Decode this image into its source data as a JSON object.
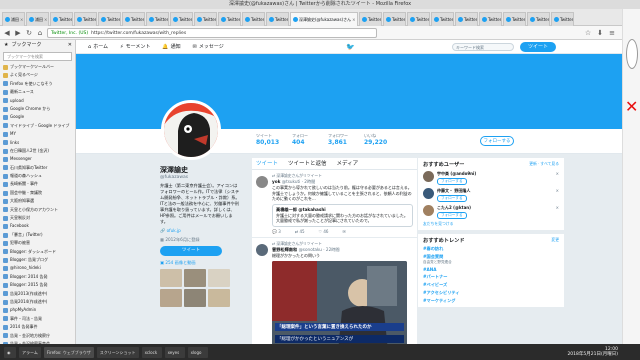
{
  "window": {
    "title": "深澤諭史(@fukazawas)さん | Twitterから削除されたツイート - Mozilla Firefox"
  },
  "tabs": [
    {
      "label": "浦田"
    },
    {
      "label": "浦田"
    },
    {
      "label": "Twitter"
    },
    {
      "label": "Twitter"
    },
    {
      "label": "Twitter"
    },
    {
      "label": "Twitter"
    },
    {
      "label": "Twitter"
    },
    {
      "label": "Twitter"
    },
    {
      "label": "Twitter"
    },
    {
      "label": "Twitter"
    },
    {
      "label": "Twitter"
    },
    {
      "label": "Twitter"
    },
    {
      "label": "深澤諭史(@fukazawas)さん"
    },
    {
      "label": "Twitter"
    },
    {
      "label": "Twitter"
    },
    {
      "label": "Twitter"
    },
    {
      "label": "Twitter"
    },
    {
      "label": "Twitter"
    },
    {
      "label": "Twitter"
    },
    {
      "label": "Twitter"
    },
    {
      "label": "Twitter"
    },
    {
      "label": "Twitter"
    }
  ],
  "active_tab_index": 12,
  "url": {
    "site_label": "Twitter, Inc. (US)",
    "address": "https://twitter.com/fukazawas/with_replies"
  },
  "sidebar": {
    "title": "ブックマーク",
    "search_placeholder": "ブックマークを検索",
    "items": [
      {
        "label": "ブックマークツールバー"
      },
      {
        "label": "よく見るページ"
      },
      {
        "label": "Firefox を使いこなそう"
      },
      {
        "label": "最新ニュース"
      },
      {
        "label": "upload"
      },
      {
        "label": "Google Chrome から"
      },
      {
        "label": "Google"
      },
      {
        "label": "マイドライブ - Google ドライブ"
      },
      {
        "label": "MY"
      },
      {
        "label": "links"
      },
      {
        "label": "在日韓国人2世 (金沢)"
      },
      {
        "label": "Messenger"
      },
      {
        "label": "石川県知事のTwitter"
      },
      {
        "label": "報道の森ハッシュ"
      },
      {
        "label": "長崎新聞 - 事件"
      },
      {
        "label": "国会中継 - 衆議院"
      },
      {
        "label": "大阪府知事選"
      },
      {
        "label": "天皇と小保方のアカウント"
      },
      {
        "label": "天皇制反対"
      },
      {
        "label": "Facebook"
      },
      {
        "label": "「暴言」(Twitter)"
      },
      {
        "label": "犯罪の被害"
      },
      {
        "label": "Blogger: ダッシュボード"
      },
      {
        "label": "Blogger: 告発ブログ"
      },
      {
        "label": "@hirono_hideki"
      },
      {
        "label": "Blogger: 2014 告発"
      },
      {
        "label": "Blogger: 2015 告発"
      },
      {
        "label": "告発2013(作成途中)"
      },
      {
        "label": "告発2014(作成途中)"
      },
      {
        "label": "phpMyAdmin"
      },
      {
        "label": "事件・司法・告発"
      },
      {
        "label": "2014 告発事件"
      },
      {
        "label": "告発・金沢地方検察庁"
      },
      {
        "label": "告発・金沢検察審査会"
      },
      {
        "label": "告発・金沢地方裁判所"
      },
      {
        "label": "Picasaウェブアルバム"
      },
      {
        "label": "行動の記録(今日)"
      }
    ]
  },
  "twitter": {
    "nav": [
      {
        "icon": "home-icon",
        "label": "ホーム"
      },
      {
        "icon": "bolt-icon",
        "label": "モーメント"
      },
      {
        "icon": "bell-icon",
        "label": "通知"
      },
      {
        "icon": "mail-icon",
        "label": "メッセージ"
      }
    ],
    "search_placeholder": "キーワード検索",
    "tweet_button": "ツイート",
    "stats": [
      {
        "label": "ツイート",
        "value": "80,013"
      },
      {
        "label": "フォロー",
        "value": "404"
      },
      {
        "label": "フォロワー",
        "value": "3,861"
      },
      {
        "label": "いいね",
        "value": "29,220"
      }
    ],
    "follow_button": "フォローする",
    "profile": {
      "name": "深澤諭史",
      "handle": "@fukazawas",
      "bio": "弁護士（第二東京弁護士会）。アイコンはフォロワーのヒール作。ITで法律（システム開発紛争、ネットトラブル・詐欺）系。ITと法の一般法務を中心に、労働事件や刑事弁護を取り扱っています。詳しくは、HP参照。ご用件はメールでお願いします。",
      "location": "",
      "link": "ofuk.jp",
      "joined": "2012年6月に登録",
      "tweet_to_button": "ツイート",
      "photos_label": "254 画像と動画"
    },
    "timeline": {
      "tabs": [
        "ツイート",
        "ツイートと返信",
        "メディア"
      ],
      "tweets": [
        {
          "context": "深澤諭史さんがリツイート",
          "author": "yok",
          "handle": "@tsukuti · 2時間",
          "text": "この事実から導かれて欲しいのは当たり前。権は守る必要があるとは言える。弁護士でしょうか。何故か擁護していることを主張されると、依頼人の利益のために動くのがこれを...",
          "quote_author": "高橋雄一郎 @takahashi",
          "quote_text": "弁護士に対する大量の懲戒請求に関わった方のお話がなされていました。大量懲戒で私が謝ったことが記事にされていたので。",
          "actions": {
            "reply": "3",
            "retweet": "45",
            "like": "46"
          }
        },
        {
          "context": "深澤諭史さんがリツイート",
          "author": "曽野松輝南和",
          "handle": "@sonotaku · 22時間",
          "text": "総理がかかったとの問いう",
          "image_caption": "「総理案件」という言葉に置き換えられたのか",
          "image_subcaption": "「総理がかかったというニュアンスが",
          "actions": {
            "reply": "",
            "retweet": "",
            "like": ""
          }
        }
      ]
    },
    "who_to_follow": {
      "title": "おすすめユーザー",
      "links": "更新 · すべて見る",
      "users": [
        {
          "name": "宇中楽 (@ando9ni)",
          "button": "フォローする"
        },
        {
          "name": "仲藤文・ 野田隆人",
          "button": "フォローする"
        },
        {
          "name": "こたん2 (@ktan)",
          "button": "フォローする"
        }
      ],
      "footer": "友だちを見つける"
    },
    "trends": {
      "title": "おすすめトレンド",
      "change": "変更",
      "items": [
        {
          "tag": "#春の訪れ",
          "desc": ""
        },
        {
          "tag": "#国会質問",
          "desc": "自由党と野党連合"
        },
        {
          "tag": "#ANA",
          "desc": ""
        },
        {
          "tag": "#パートナー",
          "desc": ""
        },
        {
          "tag": "#ベイビーズ",
          "desc": ""
        },
        {
          "tag": "#アクセシビリティ",
          "desc": ""
        },
        {
          "tag": "#マーケティング",
          "desc": ""
        }
      ]
    }
  },
  "taskbar": {
    "items": [
      {
        "label": "アラーム"
      },
      {
        "label": "Firefox: ウェブブラウザ"
      },
      {
        "label": "スクリーンショット"
      },
      {
        "label": "xclock"
      },
      {
        "label": "xeyes"
      },
      {
        "label": "xlogo"
      }
    ],
    "time": "12:00",
    "date": "2018年5月21日(月曜日)"
  }
}
